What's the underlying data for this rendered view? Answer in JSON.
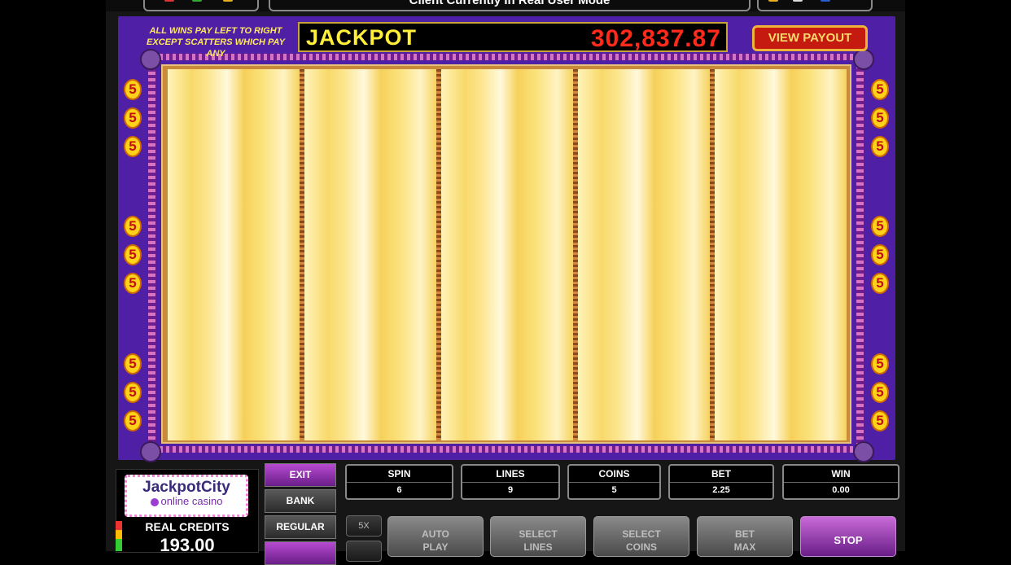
{
  "top_bar": {
    "message": "Client Currently In Real User Mode"
  },
  "header": {
    "rules_line1": "ALL WINS PAY LEFT TO RIGHT",
    "rules_line2": "EXCEPT SCATTERS WHICH PAY ANY",
    "jackpot_label": "JACKPOT",
    "jackpot_value": "302,837.87",
    "view_payout": "VIEW PAYOUT"
  },
  "line_marker_value": "5",
  "logo": {
    "main": "JackpotCity",
    "sub": "online casino"
  },
  "credits": {
    "label": "REAL CREDITS",
    "value": "193.00"
  },
  "menu": {
    "exit": "EXIT",
    "bank": "BANK",
    "regular": "REGULAR"
  },
  "stats": {
    "spin": {
      "label": "SPIN",
      "value": "6"
    },
    "lines": {
      "label": "LINES",
      "value": "9"
    },
    "coins": {
      "label": "COINS",
      "value": "5"
    },
    "bet": {
      "label": "BET",
      "value": "2.25"
    },
    "win": {
      "label": "WIN",
      "value": "0.00"
    }
  },
  "multiplier_button": "5X",
  "actions": {
    "auto_play": [
      "AUTO",
      "PLAY"
    ],
    "select_lines": [
      "SELECT",
      "LINES"
    ],
    "select_coins": [
      "SELECT",
      "COINS"
    ],
    "bet_max": [
      "BET",
      "MAX"
    ],
    "stop": "STOP"
  },
  "colors": {
    "frame": "#4f1fa6",
    "jackpot_text": "#ffee3a",
    "jackpot_value": "#ff2a1a",
    "marker": "#ffd21a",
    "stop_button": "#8a2aa8"
  }
}
